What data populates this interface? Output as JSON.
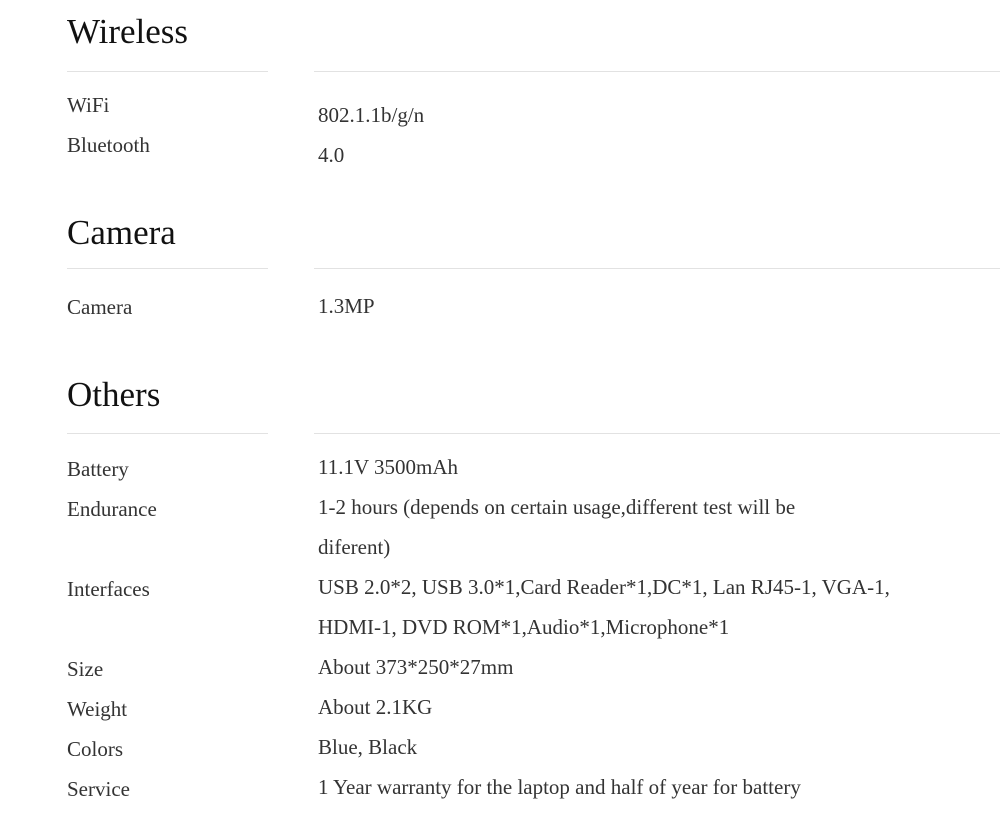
{
  "sections": [
    {
      "title": "Wireless",
      "rows": [
        {
          "label": "WiFi",
          "value": "802.1.1b/g/n"
        },
        {
          "label": "Bluetooth",
          "value": "4.0"
        }
      ]
    },
    {
      "title": "Camera",
      "rows": [
        {
          "label": "Camera",
          "value": "1.3MP"
        }
      ]
    },
    {
      "title": "Others",
      "rows": [
        {
          "label": "Battery",
          "value": "11.1V 3500mAh"
        },
        {
          "label": "Endurance",
          "value": "1-2 hours (depends on certain usage,different test will be diferent)"
        },
        {
          "label": "Interfaces",
          "value": "USB 2.0*2, USB 3.0*1,Card Reader*1,DC*1, Lan RJ45-1, VGA-1, HDMI-1, DVD ROM*1,Audio*1,Microphone*1"
        },
        {
          "label": "Size",
          "value": "About 373*250*27mm"
        },
        {
          "label": "Weight",
          "value": "About 2.1KG"
        },
        {
          "label": "Colors",
          "value": "Blue, Black"
        },
        {
          "label": "Service",
          "value": "1 Year warranty for the laptop and half of year for battery"
        }
      ]
    }
  ]
}
